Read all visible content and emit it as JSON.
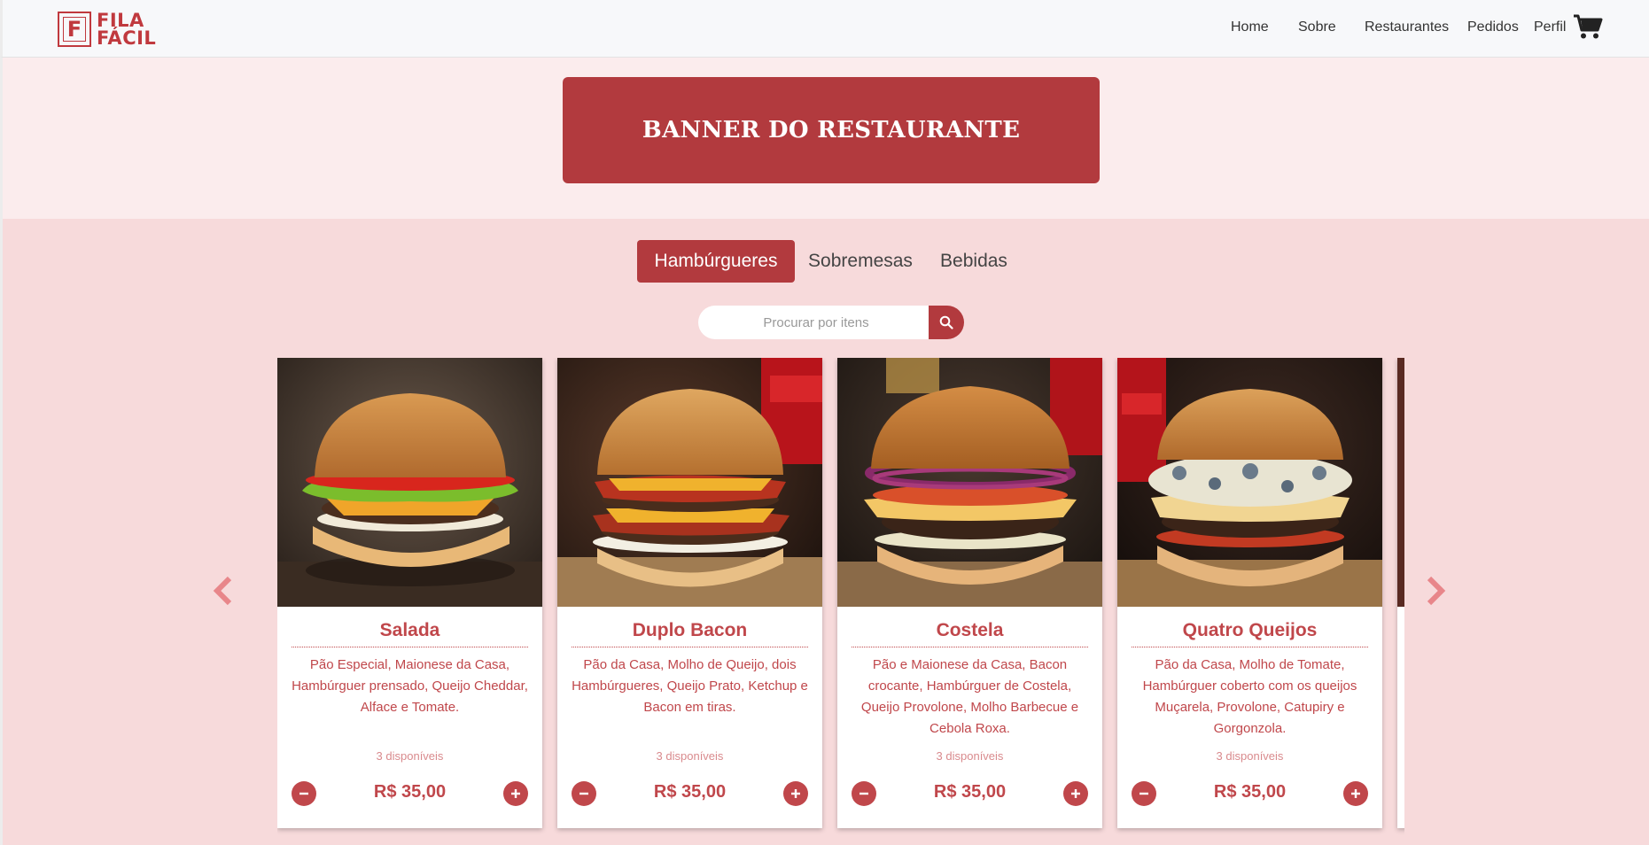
{
  "brand": {
    "logo_letter": "F",
    "line1": "FILA",
    "line2": "FÁCIL"
  },
  "nav": {
    "items": [
      "Home",
      "Sobre",
      "Restaurantes",
      "Pedidos",
      "Perfil"
    ],
    "cart_icon": "shopping-cart-icon"
  },
  "banner": {
    "text": "BANNER DO RESTAURANTE"
  },
  "tabs": [
    {
      "label": "Hambúrgueres",
      "active": true
    },
    {
      "label": "Sobremesas",
      "active": false
    },
    {
      "label": "Bebidas",
      "active": false
    }
  ],
  "search": {
    "placeholder": "Procurar por itens",
    "icon": "search-icon"
  },
  "carousel": {
    "prev_icon": "chevron-left-icon",
    "next_icon": "chevron-right-icon"
  },
  "products": [
    {
      "name": "Salada",
      "description": "Pão Especial, Maionese da Casa, Hambúrguer prensado, Queijo Cheddar, Alface e Tomate.",
      "stock": "3 disponíveis",
      "price": "R$ 35,00"
    },
    {
      "name": "Duplo Bacon",
      "description": "Pão da Casa, Molho de Queijo, dois Hambúrgueres, Queijo Prato, Ketchup e Bacon em tiras.",
      "stock": "3 disponíveis",
      "price": "R$ 35,00"
    },
    {
      "name": "Costela",
      "description": "Pão e Maionese da Casa, Bacon crocante, Hambúrguer de Costela, Queijo Provolone, Molho Barbecue e Cebola Roxa.",
      "stock": "3 disponíveis",
      "price": "R$ 35,00"
    },
    {
      "name": "Quatro Queijos",
      "description": "Pão da Casa, Molho de Tomate, Hambúrguer coberto com os queijos Muçarela, Provolone, Catupiry e Gorgonzola.",
      "stock": "3 disponíveis",
      "price": "R$ 35,00"
    }
  ],
  "colors": {
    "primary": "#b23a3e",
    "text_accent": "#c0474b",
    "bg": "#f7dadb"
  }
}
